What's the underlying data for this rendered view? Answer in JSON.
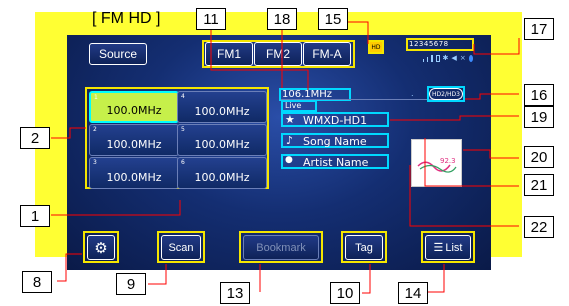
{
  "title": "[ FM HD ]",
  "top_buttons": {
    "source": "Source",
    "fm1": "FM1",
    "fm2": "FM2",
    "fma": "FM-A"
  },
  "presets": [
    {
      "num": "1",
      "freq": "100.0MHz",
      "active": true
    },
    {
      "num": "4",
      "freq": "100.0MHz",
      "active": false
    },
    {
      "num": "2",
      "freq": "100.0MHz",
      "active": false
    },
    {
      "num": "5",
      "freq": "100.0MHz",
      "active": false
    },
    {
      "num": "3",
      "freq": "100.0MHz",
      "active": false
    },
    {
      "num": "6",
      "freq": "100.0MHz",
      "active": false
    }
  ],
  "station": {
    "frequency": "106.1MHz",
    "live": "Live",
    "hd_channel": "HD2/HD3",
    "call_sign": "WMXD-HD1",
    "song": "Song Name",
    "artist": "Artist Name"
  },
  "status": {
    "hd": "HD",
    "multicast": "12345678"
  },
  "bottom_buttons": {
    "scan": "Scan",
    "bookmark": "Bookmark",
    "tag": "Tag",
    "list": "List"
  },
  "callouts": [
    "1",
    "2",
    "8",
    "9",
    "10",
    "11",
    "13",
    "14",
    "15",
    "16",
    "17",
    "18",
    "19",
    "20",
    "21",
    "22"
  ],
  "colors": {
    "background": "#ffff33",
    "screen": "#142e72",
    "highlight": "#f5e600",
    "cyan": "#00d8ff",
    "callout_line": "#ff0000"
  }
}
